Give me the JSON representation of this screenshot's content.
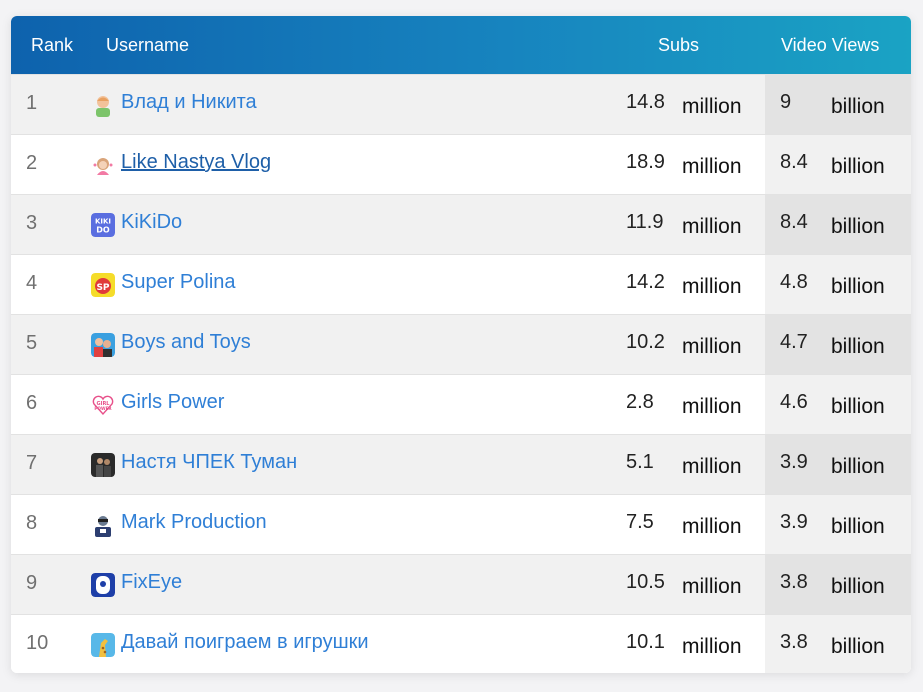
{
  "table": {
    "headers": {
      "rank": "Rank",
      "username": "Username",
      "subs": "Subs",
      "views": "Video Views"
    },
    "rows": [
      {
        "rank": "1",
        "username": "Влад и Никита",
        "avatar_icon": "kid-avatar-icon",
        "subs": "14.8",
        "subs_unit": "million",
        "views": "9",
        "views_unit": "billion"
      },
      {
        "rank": "2",
        "username": "Like Nastya Vlog",
        "avatar_icon": "girl-avatar-icon",
        "subs": "18.9",
        "subs_unit": "million",
        "views": "8.4",
        "views_unit": "billion"
      },
      {
        "rank": "3",
        "username": "KiKiDo",
        "avatar_icon": "kikido-logo-icon",
        "subs": "11.9",
        "subs_unit": "million",
        "views": "8.4",
        "views_unit": "billion"
      },
      {
        "rank": "4",
        "username": "Super Polina",
        "avatar_icon": "sp-logo-icon",
        "subs": "14.2",
        "subs_unit": "million",
        "views": "4.8",
        "views_unit": "billion"
      },
      {
        "rank": "5",
        "username": "Boys and Toys",
        "avatar_icon": "boys-avatar-icon",
        "subs": "10.2",
        "subs_unit": "million",
        "views": "4.7",
        "views_unit": "billion"
      },
      {
        "rank": "6",
        "username": "Girls Power",
        "avatar_icon": "girls-power-logo-icon",
        "subs": "2.8",
        "subs_unit": "million",
        "views": "4.6",
        "views_unit": "billion"
      },
      {
        "rank": "7",
        "username": "Настя ЧПЕК Туман",
        "avatar_icon": "dark-avatar-icon",
        "subs": "5.1",
        "subs_unit": "million",
        "views": "3.9",
        "views_unit": "billion"
      },
      {
        "rank": "8",
        "username": "Mark Production",
        "avatar_icon": "mark-avatar-icon",
        "subs": "7.5",
        "subs_unit": "million",
        "views": "3.9",
        "views_unit": "billion"
      },
      {
        "rank": "9",
        "username": "FixEye",
        "avatar_icon": "fixeye-avatar-icon",
        "subs": "10.5",
        "subs_unit": "million",
        "views": "3.8",
        "views_unit": "billion"
      },
      {
        "rank": "10",
        "username": "Давай поиграем в игрушки",
        "avatar_icon": "giraffe-avatar-icon",
        "subs": "10.1",
        "subs_unit": "million",
        "views": "3.8",
        "views_unit": "billion"
      }
    ]
  },
  "colors": {
    "header_start": "#0e62ad",
    "header_end": "#1aa3c4",
    "link": "#2f7fd6"
  },
  "logo_text": {
    "kikido": "KIKI DO",
    "super_polina": "SP",
    "girls_power": "GIRL POWER"
  }
}
